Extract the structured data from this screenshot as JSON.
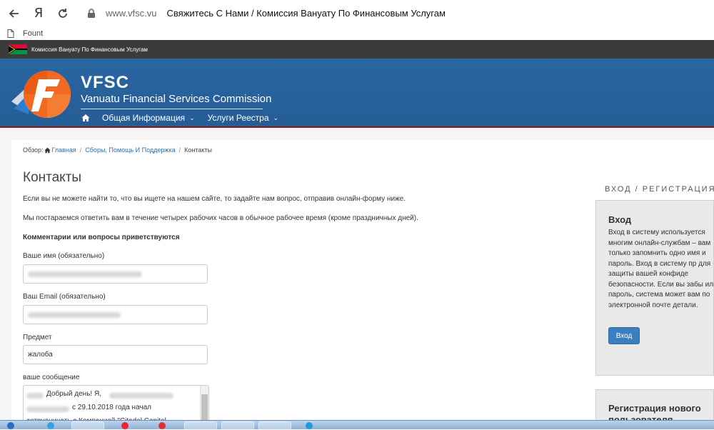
{
  "browser": {
    "back_icon": "arrow-left-icon",
    "yandex_label": "Я",
    "reload_icon": "reload-icon",
    "lock_icon": "lock-icon",
    "url": "www.vfsc.vu",
    "page_title": "Свяжитесь С Нами / Комиссия Вануату По Финансовым Услугам",
    "bookmark_label": "Fount"
  },
  "site": {
    "gov_strip_text": "Комиссия Вануату По Финансовым Услугам",
    "brand_title": "VFSC",
    "brand_subtitle": "Vanuatu Financial Services Commission",
    "nav": [
      {
        "label": "Общая Информация"
      },
      {
        "label": "Услуги Реестра"
      }
    ]
  },
  "breadcrumb": {
    "prefix": "Обзор:",
    "items": [
      "Главная",
      "Сборы, Помощь И Поддержка",
      "Контакты"
    ]
  },
  "page": {
    "title": "Контакты",
    "intro1": "Если вы не можете найти то, что вы ищете на нашем сайте, то задайте нам вопрос, отправив онлайн-форму ниже.",
    "intro2": "Мы постараемся ответить вам в течение четырех рабочих часов в обычное рабочее время (кроме праздничных дней).",
    "comments_heading": "Комментарии или вопросы приветствуются"
  },
  "form": {
    "name_label": "Ваше имя (обязательно)",
    "email_label": "Ваш Email (обязательно)",
    "subject_label": "Предмет",
    "subject_value": "жалоба",
    "message_label": "ваше сообщение",
    "message_line1": "Добрый день! Я,",
    "message_line2": "с 29.10.2018 года начал",
    "message_line3": "сотрудничать с Компанией \"Citadel Capital"
  },
  "sidebar": {
    "section_title": "ВХОД / РЕГИСТРАЦИЯ",
    "login_title": "Вход",
    "login_text": "Вход в систему используется многим онлайн-службам – вам только запомнить одно имя и пароль. Вход в систему пр для защиты вашей конфиде безопасности. Если вы забы или пароль, система может вам по электронной почте детали.",
    "login_button": "Вход",
    "register_title": "Регистрация нового пользователя"
  }
}
